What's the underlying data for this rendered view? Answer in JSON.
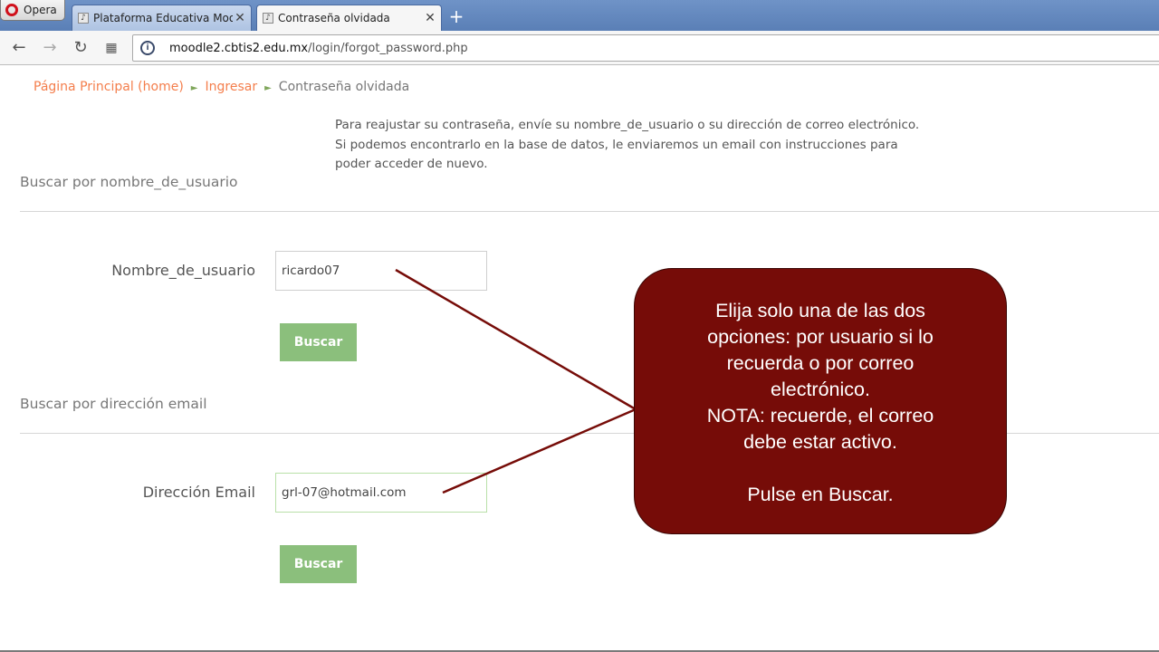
{
  "browser": {
    "menu_label": "Opera",
    "tabs": [
      {
        "title": "Plataforma Educativa Moo",
        "active": false
      },
      {
        "title": "Contraseña olvidada",
        "active": true
      }
    ],
    "close_glyph": "✕",
    "new_tab_glyph": "+",
    "url_host": "moodle2.cbtis2.edu.mx",
    "url_path": "/login/forgot_password.php"
  },
  "breadcrumb": {
    "home": "Página Principal (home)",
    "login": "Ingresar",
    "current": "Contraseña olvidada",
    "separator": "►"
  },
  "intro_lines": [
    "Para reajustar su contraseña, envíe su nombre_de_usuario o su dirección de correo electrónico.",
    "Si podemos encontrarlo en la base de datos, le enviaremos un email con instrucciones para",
    "poder acceder de nuevo."
  ],
  "username_section": {
    "legend": "Buscar por nombre_de_usuario",
    "label": "Nombre_de_usuario",
    "value": "ricardo07",
    "button": "Buscar"
  },
  "email_section": {
    "legend": "Buscar por dirección email",
    "label": "Dirección Email",
    "value": "grl-07@hotmail.com",
    "button": "Buscar"
  },
  "callout_text": "Elija solo una de las dos\nopciones: por usuario si lo\nrecuerda o por correo\nelectrónico.\nNOTA: recuerde, el correo\ndebe estar activo.\n\nPulse en Buscar.",
  "colors": {
    "link": "#f47e4c",
    "button": "#8bbf7c",
    "callout": "#760c08"
  }
}
